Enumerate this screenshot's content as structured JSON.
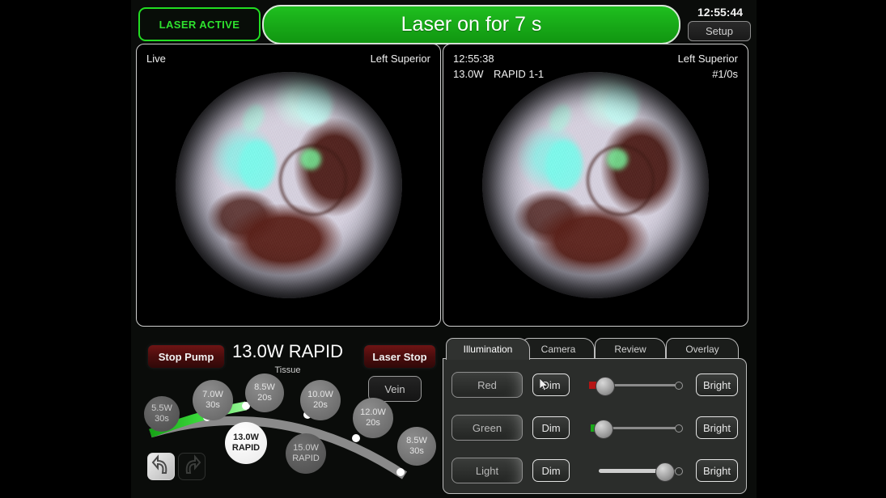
{
  "topbar": {
    "laser_active_label": "LASER ACTIVE",
    "banner_text": "Laser on for 7 s",
    "clock": "12:55:44",
    "setup_label": "Setup",
    "active_color": "#22dd22",
    "banner_color": "#17a817"
  },
  "live_panel": {
    "source_label": "Live",
    "position_label": "Left Superior"
  },
  "reference_panel": {
    "timestamp": "12:55:38",
    "power": "13.0W",
    "mode": "RAPID 1-1",
    "position_label": "Left Superior",
    "counter": "#1/0s"
  },
  "laser_controls": {
    "stop_pump_label": "Stop Pump",
    "laser_stop_label": "Laser Stop",
    "vein_label": "Vein",
    "title": "13.0W RAPID",
    "subtitle": "Tissue",
    "undo_icon": "undo-arrow-icon",
    "redo_icon": "redo-arrow-icon",
    "presets": [
      {
        "power": "5.5W",
        "time": "30s",
        "state": "dim"
      },
      {
        "power": "7.0W",
        "time": "30s",
        "state": "normal"
      },
      {
        "power": "8.5W",
        "time": "20s",
        "state": "normal"
      },
      {
        "power": "10.0W",
        "time": "20s",
        "state": "normal"
      },
      {
        "power": "12.0W",
        "time": "20s",
        "state": "normal"
      },
      {
        "power": "8.5W",
        "time": "30s",
        "state": "normal"
      },
      {
        "power": "13.0W",
        "time": "RAPID",
        "state": "selected"
      },
      {
        "power": "15.0W",
        "time": "RAPID",
        "state": "dim"
      }
    ],
    "arc_progress_color": "#2fd22f",
    "arc_track_color": "#8a8a8a"
  },
  "right_panel": {
    "tabs": [
      {
        "label": "Illumination",
        "active": true
      },
      {
        "label": "Camera",
        "active": false
      },
      {
        "label": "Review",
        "active": false
      },
      {
        "label": "Overlay",
        "active": false
      }
    ],
    "rows": [
      {
        "channel": "Red",
        "dim_label": "Dim",
        "bright_label": "Bright",
        "marker_color": "#b51414",
        "value": 8,
        "cursor": true
      },
      {
        "channel": "Green",
        "dim_label": "Dim",
        "bright_label": "Bright",
        "marker_color": "#17a817",
        "value": 6,
        "cursor": false
      },
      {
        "channel": "Light",
        "dim_label": "Dim",
        "bright_label": "Bright",
        "marker_color": "",
        "value": 52,
        "cursor": false
      }
    ]
  }
}
